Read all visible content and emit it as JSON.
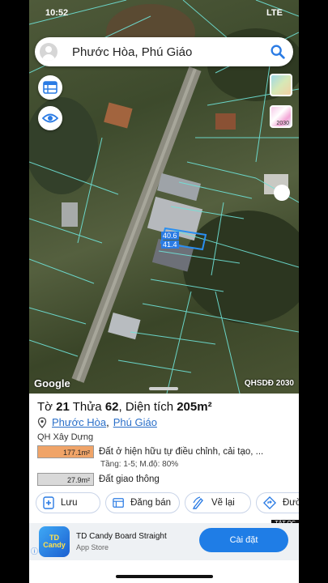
{
  "status": {
    "time": "10:52",
    "right": "LTE"
  },
  "search": {
    "query": "Phước Hòa, Phú Giáo"
  },
  "map": {
    "plot_dims": [
      "40.6",
      "41.4"
    ],
    "attribution": "Google",
    "layer_name": "QHSDĐ 2030",
    "tile_year": "2030"
  },
  "parcel": {
    "title_prefix": "Tờ",
    "sheet": "21",
    "lot_prefix": "Thửa",
    "lot": "62",
    "area_label": ", Diện tích",
    "area": "205m²",
    "commune": "Phước Hòa",
    "district": "Phú Giáo",
    "separator": ",",
    "plan_type": "QH Xây Dựng",
    "zones": [
      {
        "area": "177.1m²",
        "desc": "Đất ở hiện hữu tự điều chỉnh, cải tạo, ...",
        "color": "#f0a468"
      },
      {
        "area": "27.9m²",
        "desc": "Đất giao thông",
        "color": "#d9d9d9"
      }
    ],
    "zone_detail": "Tầng: 1-5; M.độ: 80%"
  },
  "actions": [
    {
      "label": "Lưu",
      "icon": "add-doc-icon"
    },
    {
      "label": "Đăng bán",
      "icon": "listing-icon"
    },
    {
      "label": "Vẽ lại",
      "icon": "redraw-icon"
    },
    {
      "label": "Đườ",
      "icon": "directions-icon"
    }
  ],
  "ad": {
    "tag": "TẮT QC",
    "app_name": "TD Candy Board Straight",
    "store": "App Store",
    "logo_text": "TD Candy",
    "button": "Cài đặt"
  }
}
